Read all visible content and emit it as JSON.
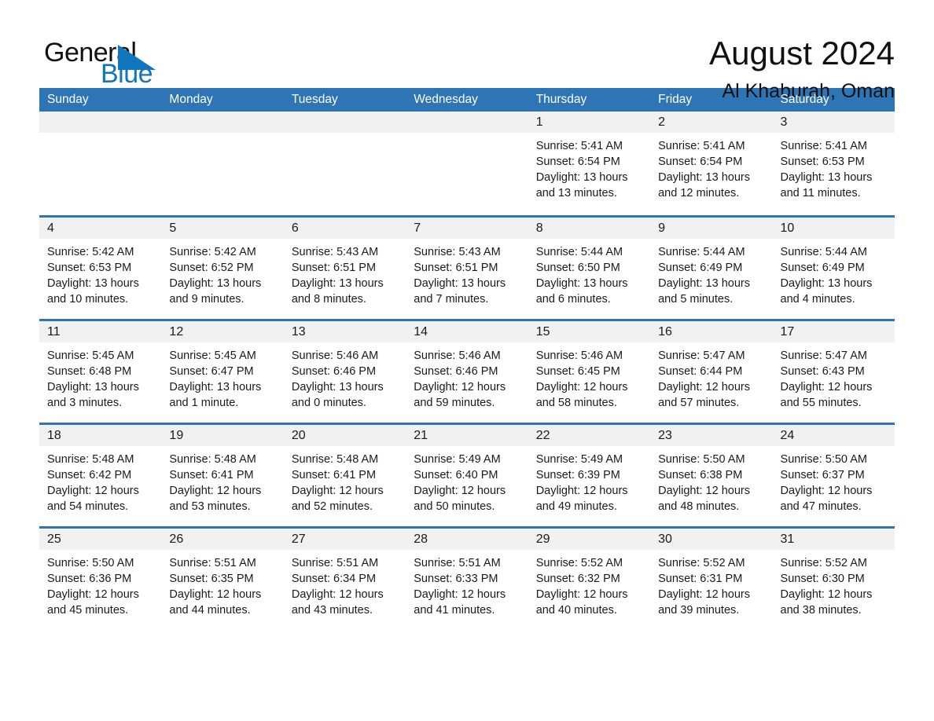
{
  "brand": {
    "name_part1": "General",
    "name_part2": "Blue",
    "triangle_color": "#1276bd",
    "accent_color": "#2E75B6"
  },
  "header": {
    "title": "August 2024",
    "subtitle": "Al Khaburah, Oman"
  },
  "calendar": {
    "weekday_headers": [
      "Sunday",
      "Monday",
      "Tuesday",
      "Wednesday",
      "Thursday",
      "Friday",
      "Saturday"
    ],
    "header_bg": "#2E75B6",
    "daynum_bg": "#F1F1F1",
    "weeks": [
      [
        {
          "day": "",
          "lines": []
        },
        {
          "day": "",
          "lines": []
        },
        {
          "day": "",
          "lines": []
        },
        {
          "day": "",
          "lines": []
        },
        {
          "day": "1",
          "lines": [
            "Sunrise: 5:41 AM",
            "Sunset: 6:54 PM",
            "Daylight: 13 hours",
            "and 13 minutes."
          ]
        },
        {
          "day": "2",
          "lines": [
            "Sunrise: 5:41 AM",
            "Sunset: 6:54 PM",
            "Daylight: 13 hours",
            "and 12 minutes."
          ]
        },
        {
          "day": "3",
          "lines": [
            "Sunrise: 5:41 AM",
            "Sunset: 6:53 PM",
            "Daylight: 13 hours",
            "and 11 minutes."
          ]
        }
      ],
      [
        {
          "day": "4",
          "lines": [
            "Sunrise: 5:42 AM",
            "Sunset: 6:53 PM",
            "Daylight: 13 hours",
            "and 10 minutes."
          ]
        },
        {
          "day": "5",
          "lines": [
            "Sunrise: 5:42 AM",
            "Sunset: 6:52 PM",
            "Daylight: 13 hours",
            "and 9 minutes."
          ]
        },
        {
          "day": "6",
          "lines": [
            "Sunrise: 5:43 AM",
            "Sunset: 6:51 PM",
            "Daylight: 13 hours",
            "and 8 minutes."
          ]
        },
        {
          "day": "7",
          "lines": [
            "Sunrise: 5:43 AM",
            "Sunset: 6:51 PM",
            "Daylight: 13 hours",
            "and 7 minutes."
          ]
        },
        {
          "day": "8",
          "lines": [
            "Sunrise: 5:44 AM",
            "Sunset: 6:50 PM",
            "Daylight: 13 hours",
            "and 6 minutes."
          ]
        },
        {
          "day": "9",
          "lines": [
            "Sunrise: 5:44 AM",
            "Sunset: 6:49 PM",
            "Daylight: 13 hours",
            "and 5 minutes."
          ]
        },
        {
          "day": "10",
          "lines": [
            "Sunrise: 5:44 AM",
            "Sunset: 6:49 PM",
            "Daylight: 13 hours",
            "and 4 minutes."
          ]
        }
      ],
      [
        {
          "day": "11",
          "lines": [
            "Sunrise: 5:45 AM",
            "Sunset: 6:48 PM",
            "Daylight: 13 hours",
            "and 3 minutes."
          ]
        },
        {
          "day": "12",
          "lines": [
            "Sunrise: 5:45 AM",
            "Sunset: 6:47 PM",
            "Daylight: 13 hours",
            "and 1 minute."
          ]
        },
        {
          "day": "13",
          "lines": [
            "Sunrise: 5:46 AM",
            "Sunset: 6:46 PM",
            "Daylight: 13 hours",
            "and 0 minutes."
          ]
        },
        {
          "day": "14",
          "lines": [
            "Sunrise: 5:46 AM",
            "Sunset: 6:46 PM",
            "Daylight: 12 hours",
            "and 59 minutes."
          ]
        },
        {
          "day": "15",
          "lines": [
            "Sunrise: 5:46 AM",
            "Sunset: 6:45 PM",
            "Daylight: 12 hours",
            "and 58 minutes."
          ]
        },
        {
          "day": "16",
          "lines": [
            "Sunrise: 5:47 AM",
            "Sunset: 6:44 PM",
            "Daylight: 12 hours",
            "and 57 minutes."
          ]
        },
        {
          "day": "17",
          "lines": [
            "Sunrise: 5:47 AM",
            "Sunset: 6:43 PM",
            "Daylight: 12 hours",
            "and 55 minutes."
          ]
        }
      ],
      [
        {
          "day": "18",
          "lines": [
            "Sunrise: 5:48 AM",
            "Sunset: 6:42 PM",
            "Daylight: 12 hours",
            "and 54 minutes."
          ]
        },
        {
          "day": "19",
          "lines": [
            "Sunrise: 5:48 AM",
            "Sunset: 6:41 PM",
            "Daylight: 12 hours",
            "and 53 minutes."
          ]
        },
        {
          "day": "20",
          "lines": [
            "Sunrise: 5:48 AM",
            "Sunset: 6:41 PM",
            "Daylight: 12 hours",
            "and 52 minutes."
          ]
        },
        {
          "day": "21",
          "lines": [
            "Sunrise: 5:49 AM",
            "Sunset: 6:40 PM",
            "Daylight: 12 hours",
            "and 50 minutes."
          ]
        },
        {
          "day": "22",
          "lines": [
            "Sunrise: 5:49 AM",
            "Sunset: 6:39 PM",
            "Daylight: 12 hours",
            "and 49 minutes."
          ]
        },
        {
          "day": "23",
          "lines": [
            "Sunrise: 5:50 AM",
            "Sunset: 6:38 PM",
            "Daylight: 12 hours",
            "and 48 minutes."
          ]
        },
        {
          "day": "24",
          "lines": [
            "Sunrise: 5:50 AM",
            "Sunset: 6:37 PM",
            "Daylight: 12 hours",
            "and 47 minutes."
          ]
        }
      ],
      [
        {
          "day": "25",
          "lines": [
            "Sunrise: 5:50 AM",
            "Sunset: 6:36 PM",
            "Daylight: 12 hours",
            "and 45 minutes."
          ]
        },
        {
          "day": "26",
          "lines": [
            "Sunrise: 5:51 AM",
            "Sunset: 6:35 PM",
            "Daylight: 12 hours",
            "and 44 minutes."
          ]
        },
        {
          "day": "27",
          "lines": [
            "Sunrise: 5:51 AM",
            "Sunset: 6:34 PM",
            "Daylight: 12 hours",
            "and 43 minutes."
          ]
        },
        {
          "day": "28",
          "lines": [
            "Sunrise: 5:51 AM",
            "Sunset: 6:33 PM",
            "Daylight: 12 hours",
            "and 41 minutes."
          ]
        },
        {
          "day": "29",
          "lines": [
            "Sunrise: 5:52 AM",
            "Sunset: 6:32 PM",
            "Daylight: 12 hours",
            "and 40 minutes."
          ]
        },
        {
          "day": "30",
          "lines": [
            "Sunrise: 5:52 AM",
            "Sunset: 6:31 PM",
            "Daylight: 12 hours",
            "and 39 minutes."
          ]
        },
        {
          "day": "31",
          "lines": [
            "Sunrise: 5:52 AM",
            "Sunset: 6:30 PM",
            "Daylight: 12 hours",
            "and 38 minutes."
          ]
        }
      ]
    ]
  }
}
